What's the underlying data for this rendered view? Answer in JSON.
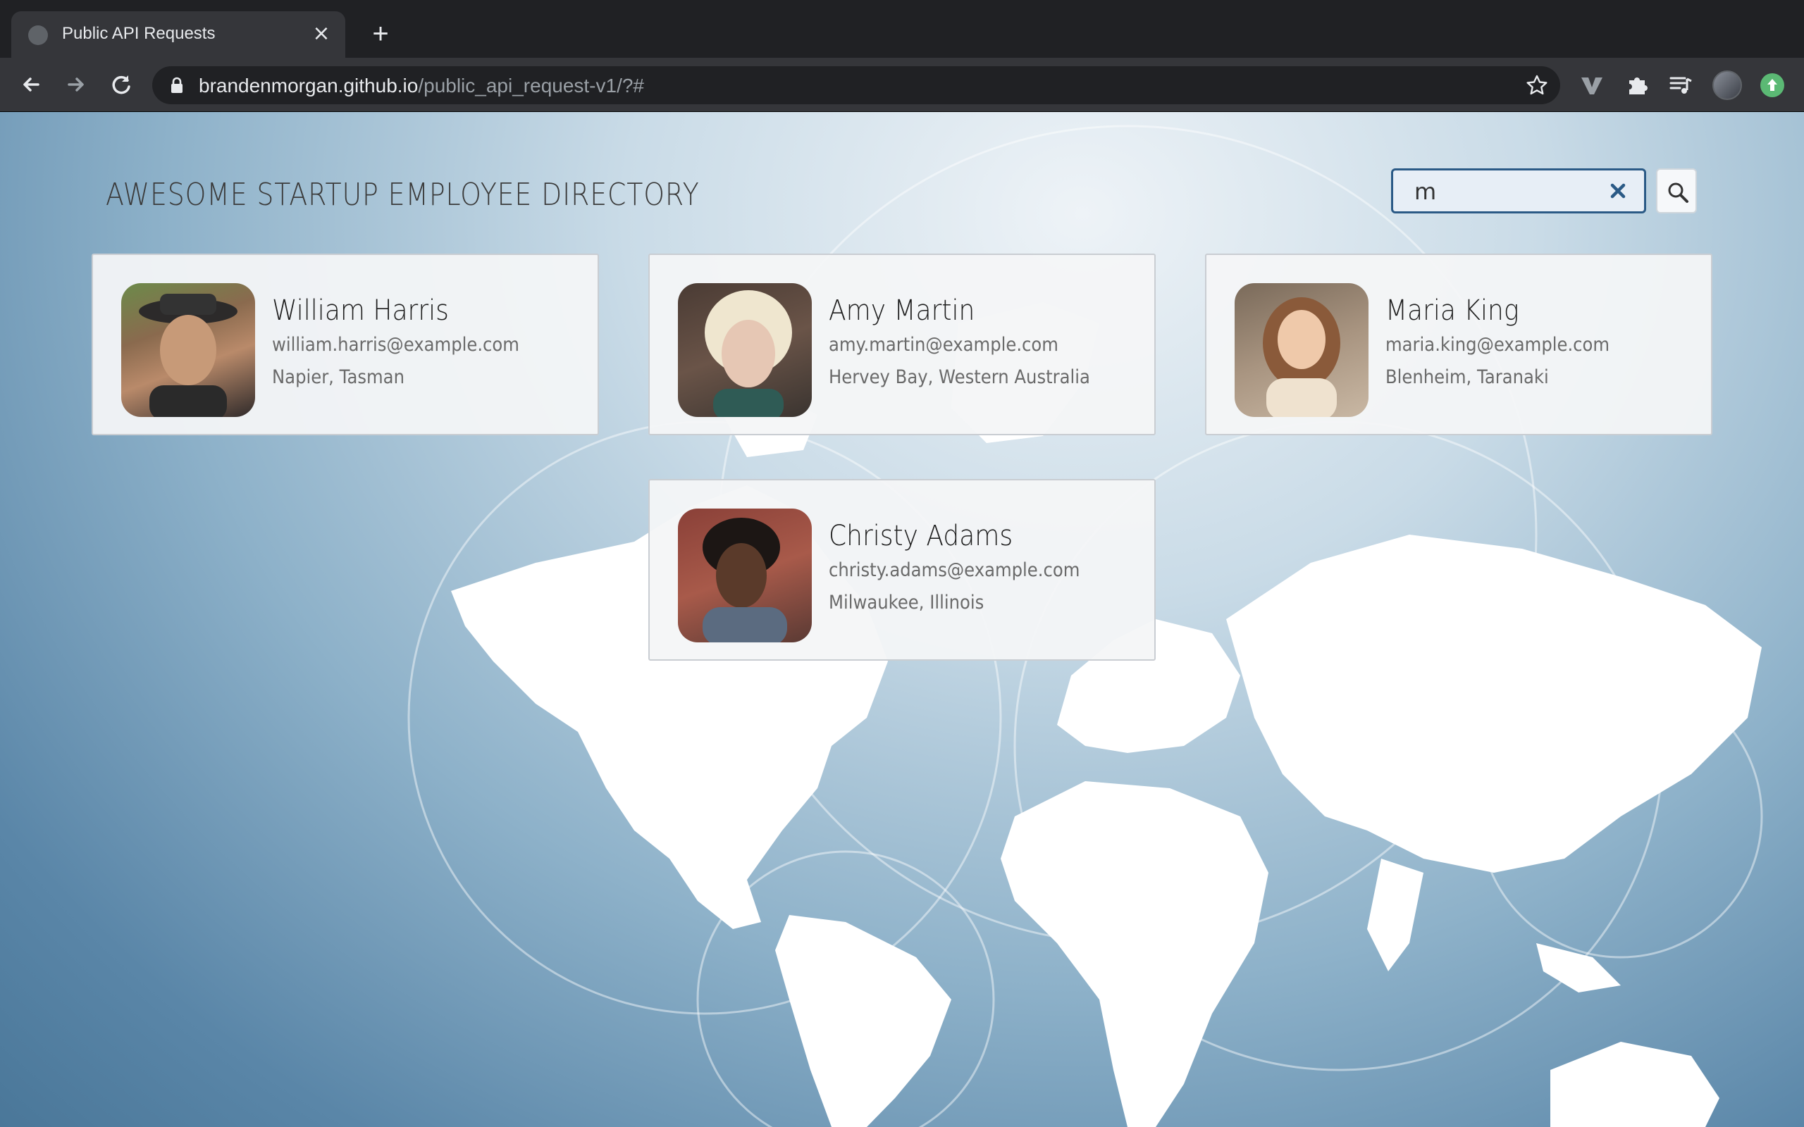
{
  "browser": {
    "tab_title": "Public API Requests",
    "url_host": "brandenmorgan.github.io",
    "url_path": "/public_api_request-v1/?#"
  },
  "page": {
    "title": "AWESOME STARTUP EMPLOYEE DIRECTORY",
    "search": {
      "value": "m"
    }
  },
  "employees": [
    {
      "name": "William Harris",
      "email": "william.harris@example.com",
      "location": "Napier, Tasman"
    },
    {
      "name": "Amy Martin",
      "email": "amy.martin@example.com",
      "location": "Hervey Bay, Western Australia"
    },
    {
      "name": "Maria King",
      "email": "maria.king@example.com",
      "location": "Blenheim, Taranaki"
    },
    {
      "name": "Christy Adams",
      "email": "christy.adams@example.com",
      "location": "Milwaukee, Illinois"
    }
  ],
  "colors": {
    "accent": "#2b5a86",
    "chrome_dark": "#202124",
    "chrome_toolbar": "#35363a"
  }
}
